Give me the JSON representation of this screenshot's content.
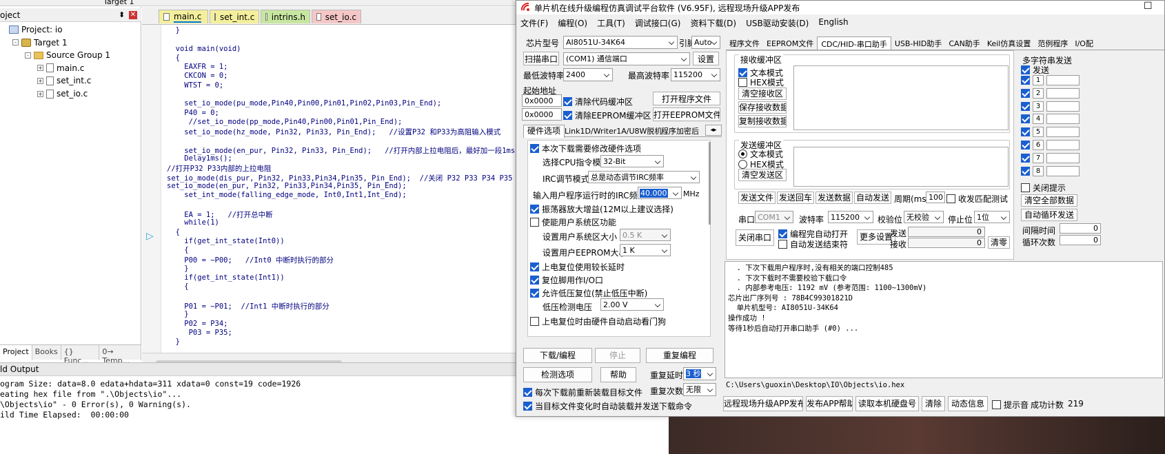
{
  "ide": {
    "toolbar_target": "Target 1",
    "project_panel_title": "oject",
    "tree": [
      {
        "label": "Project: io",
        "indent": 0,
        "icon": "project-icon",
        "toggle": ""
      },
      {
        "label": "Target 1",
        "indent": 1,
        "icon": "target-icon",
        "toggle": "-"
      },
      {
        "label": "Source Group 1",
        "indent": 2,
        "icon": "folder-icon",
        "toggle": "-"
      },
      {
        "label": "main.c",
        "indent": 3,
        "icon": "file-icon",
        "toggle": "+"
      },
      {
        "label": "set_int.c",
        "indent": 3,
        "icon": "file-icon",
        "toggle": "+"
      },
      {
        "label": "set_io.c",
        "indent": 3,
        "icon": "file-icon",
        "toggle": "+"
      }
    ],
    "bottom_tabs": [
      "Project",
      "Books",
      "{} Func...",
      "0→ Temp..."
    ],
    "editor_tabs": [
      {
        "label": "main.c",
        "color": "#f4ef9c",
        "active": true
      },
      {
        "label": "set_int.c",
        "color": "#f4ef9c",
        "active": false
      },
      {
        "label": "intrins.h",
        "color": "#c7e7a1",
        "active": false
      },
      {
        "label": "set_io.c",
        "color": "#f5c6c6",
        "active": false
      }
    ],
    "code_lines": [
      "  }",
      "",
      "  void main(void)",
      "  {",
      "    EAXFR = 1;",
      "    CKCON = 0;",
      "    WTST = 0;",
      "",
      "    set_io_mode(pu_mode,Pin40,Pin00,Pin01,Pin02,Pin03,Pin_End);",
      "    P40 = 0;",
      "     //set_io_mode(pp_mode,Pin40,Pin00,Pin01,Pin_End);",
      "    set_io_mode(hz_mode, Pin32, Pin33, Pin_End);   //设置P32 和P33为高阻输入模式",
      "",
      "    set_io_mode(en_pur, Pin32, Pin33, Pin_End);   //打开内部上拉电阻后，最好加一段1ms的延时，",
      "    Delay1ms();",
      "//打开P32 P33内部的上拉电阻",
      "set_io_mode(dis_pur, Pin32, Pin33,Pin34,Pin35, Pin_End);  //关闭 P32 P33 P34 P35 内部",
      "set_io_mode(en_pur, Pin32, Pin33,Pin34,Pin35, Pin_End);",
      "    set_int_mode(falling_edge_mode, Int0,Int1,Int_End);",
      "",
      "    EA = 1;   //打开总中断",
      "    while(1)",
      "  {",
      "    if(get_int_state(Int0))",
      "    {",
      "    P00 = ~P00;   //Int0 中断时执行的部分",
      "    }",
      "    if(get_int_state(Int1))",
      "    {",
      "",
      "    P01 = ~P01;  //Int1 中断时执行的部分",
      "    }",
      "    P02 = P34;",
      "     P03 = P35;",
      "  }"
    ],
    "build_output_title": "ld Output",
    "build_output": [
      "ogram Size: data=8.0 edata+hdata=311 xdata=0 const=19 code=1926",
      "eating hex file from \".\\Objects\\io\"...",
      "\\Objects\\io\" - 0 Error(s), 0 Warning(s).",
      "ild Time Elapsed:  00:00:00"
    ]
  },
  "isp": {
    "title": "单片机在线升级编程仿真调试平台软件 (V6.95F), 远程现场升级APP发布",
    "menu": [
      "文件(F)",
      "编程(O)",
      "工具(T)",
      "调试接口(G)",
      "资料下载(D)",
      "USB驱动安装(D)",
      "English"
    ],
    "chip_label": "芯片型号",
    "chip_value": "AI8051U-34K64",
    "pins_label": "引脚数",
    "pins_value": "Auto",
    "scan_label": "扫描串口",
    "port_value": "(COM1) 通信端口",
    "settings_label": "设置",
    "min_baud_label": "最低波特率",
    "min_baud": "2400",
    "max_baud_label": "最高波特率",
    "max_baud": "115200",
    "start_addr_label": "起始地址",
    "addr1": "0x0000",
    "clear_code": "清除代码缓冲区",
    "open_prog": "打开程序文件",
    "addr2": "0x0000",
    "clear_eeprom": "清除EEPROM缓冲区",
    "open_eeprom": "打开EEPROM文件",
    "option_tabs": [
      "硬件选项",
      "Link1D/Writer1A/U8W脱机",
      "程序加密后"
    ],
    "hw": {
      "modify": "本次下载需要修改硬件选项",
      "cpu_label": "选择CPU指令模式",
      "cpu_value": "32-Bit",
      "irc_label": "IRC调节模式",
      "irc_value": "总是动态调节IRC频率",
      "freq_label": "输入用户程序运行时的IRC频率",
      "freq_value": "40.000",
      "freq_unit": "MHz",
      "osc_gain": "振荡器放大增益(12M以上建议选择)",
      "user_sys": "使能用户系统区功能",
      "user_sys_size_label": "设置用户系统区大小",
      "user_sys_size": "0.5 K",
      "user_eeprom_label": "设置用户EEPROM大小",
      "user_eeprom": "1   K",
      "long_delay": "上电复位使用较长延时",
      "reset_io": "复位脚用作I/O口",
      "lvr": "允许低压复位(禁止低压中断)",
      "lvd_label": "低压检测电压",
      "lvd_value": "2.00 V",
      "wdt": "上电复位时由硬件自动启动看门狗"
    },
    "download": "下载/编程",
    "stop": "停止",
    "reprogram": "重复编程",
    "check": "检测选项",
    "help": "帮助",
    "repeat_delay_label": "重复延时",
    "repeat_delay": "3 秒",
    "repeat_count_label": "重复次数",
    "repeat_count": "无限",
    "reload_each": "每次下载前重新装载目标文件",
    "auto_load": "当目标文件变化时自动装载并发送下载命令",
    "right_tabs": [
      "程序文件",
      "EEPROM文件",
      "CDC/HID-串口助手",
      "USB-HID助手",
      "CAN助手",
      "Keil仿真设置",
      "范例程序",
      "I/O配"
    ],
    "rx": {
      "title": "接收缓冲区",
      "text_mode": "文本模式",
      "hex_mode": "HEX模式",
      "clear": "清空接收区",
      "save": "保存接收数据",
      "copy": "复制接收数据"
    },
    "tx": {
      "title": "发送缓冲区",
      "text_mode": "文本模式",
      "hex_mode": "HEX模式",
      "clear": "清空发送区"
    },
    "send_file": "发送文件",
    "send_enter": "发送回车",
    "send_data": "发送数据",
    "auto_send": "自动发送",
    "period_label": "周期(ms)",
    "period": "100",
    "match": "收发匹配测试",
    "serial_label": "串口",
    "serial_value": "COM1",
    "baud_label": "波特率",
    "baud_value": "115200",
    "parity_label": "校验位",
    "parity_value": "无校验",
    "stop_label": "停止位",
    "stop_value": "1位",
    "close_port": "关闭串口",
    "auto_open": "编程完自动打开",
    "auto_end": "自动发送结束符",
    "more": "更多设置",
    "tx_count_label": "发送",
    "tx_count": "0",
    "rx_count_label": "接收",
    "rx_count": "0",
    "clear_zero": "清零",
    "multi": {
      "title": "多字符串发送",
      "send": "发送",
      "items": [
        "1",
        "2",
        "3",
        "4",
        "5",
        "6",
        "7",
        "8"
      ],
      "close_tip": "关闭提示",
      "clear_all": "清空全部数据",
      "auto_loop": "自动循环发送",
      "interval_label": "间隔时间",
      "interval": "0",
      "loops_label": "循环次数",
      "loops": "0"
    },
    "log": [
      "  . 下次下载用户程序时,没有相关的端口控制485",
      "  . 下次下载时不需要校验下载口令",
      "  . 内部参考电压: 1192 mV (参考范围: 1100~1300mV)",
      "芯片出厂序列号 : 78B4C99301821D",
      "",
      "  单片机型号: AI8051U-34K64",
      "",
      "操作成功 !",
      "",
      "等待1秒后自动打开串口助手 (#0) ..."
    ],
    "path": "C:\\Users\\guoxin\\Desktop\\IO\\Objects\\io.hex",
    "bottom": {
      "remote": "远程现场升级APP发布",
      "publish": "发布APP帮助",
      "read_disk": "读取本机硬盘号",
      "clear": "清除",
      "anim": "动态信息",
      "tone": "提示音",
      "success_label": "成功计数",
      "success": "219"
    }
  },
  "colors": {
    "accent": "#1a5fcf",
    "tab_active_underline": "#0078d7",
    "code_text": "#000080"
  }
}
